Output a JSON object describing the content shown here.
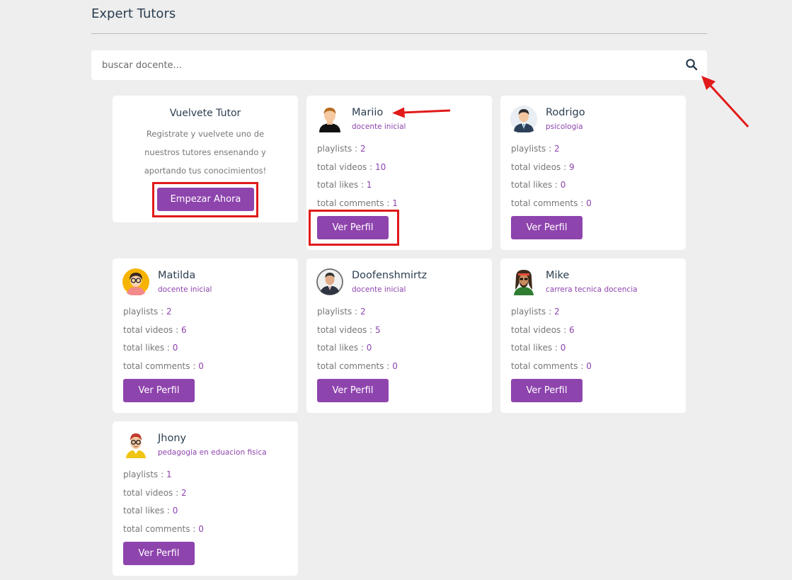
{
  "page": {
    "title": "Expert Tutors"
  },
  "search": {
    "placeholder": "buscar docente...",
    "value": ""
  },
  "become_tutor": {
    "title": "Vuelvete Tutor",
    "text": "Registrate y vuelvete uno de nuestros tutores ensenando y aportando tus conocimientos!",
    "button_label": "Empezar Ahora"
  },
  "labels": {
    "playlists": "playlists : ",
    "videos": "total videos : ",
    "likes": "total likes : ",
    "comments": "total comments : ",
    "view_profile": "Ver Perfil"
  },
  "tutors": [
    {
      "name": "Mariio",
      "specialty": "docente inicial",
      "playlists": "2",
      "videos": "10",
      "likes": "1",
      "comments": "1",
      "avatar": "man-avatar-icon"
    },
    {
      "name": "Rodrigo",
      "specialty": "psicologia",
      "playlists": "2",
      "videos": "9",
      "likes": "0",
      "comments": "0",
      "avatar": "businessman-avatar-icon"
    },
    {
      "name": "Matilda",
      "specialty": "docente inicial",
      "playlists": "2",
      "videos": "6",
      "likes": "0",
      "comments": "0",
      "avatar": "woman-glasses-avatar-icon"
    },
    {
      "name": "Doofenshmirtz",
      "specialty": "docente inicial",
      "playlists": "2",
      "videos": "5",
      "likes": "0",
      "comments": "0",
      "avatar": "suit-man-avatar-icon"
    },
    {
      "name": "Mike",
      "specialty": "carrera tecnica docencia",
      "playlists": "2",
      "videos": "6",
      "likes": "0",
      "comments": "0",
      "avatar": "hippie-man-avatar-icon"
    },
    {
      "name": "Jhony",
      "specialty": "pedagogia en eduacion fisica",
      "playlists": "1",
      "videos": "2",
      "likes": "0",
      "comments": "0",
      "avatar": "glasses-man-avatar-icon"
    }
  ],
  "colors": {
    "accent": "#8e44ad",
    "annotation": "#e11a1a",
    "background": "#eeeeee"
  }
}
